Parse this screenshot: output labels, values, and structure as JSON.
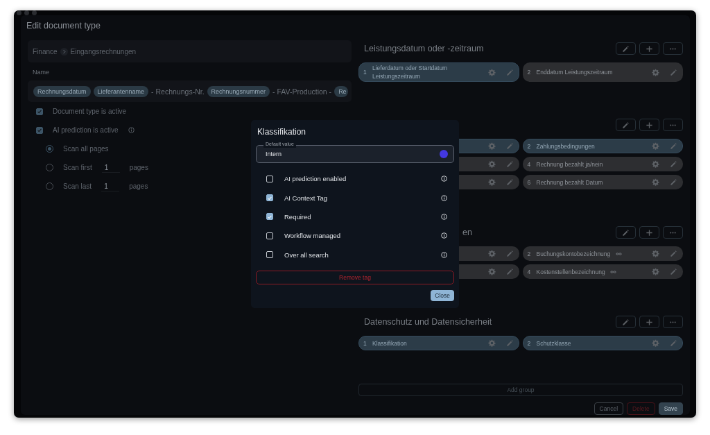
{
  "window": {
    "title": "Edit document type"
  },
  "breadcrumb": [
    "Finance",
    "Eingangsrechnungen"
  ],
  "name_field": {
    "label": "Name",
    "parts": [
      {
        "kind": "chip",
        "text": "Rechnungsdatum"
      },
      {
        "kind": "chip",
        "text": "Lieferantenname"
      },
      {
        "kind": "text",
        "text": "- Rechnungs-Nr."
      },
      {
        "kind": "chip",
        "text": "Rechnungsnummer"
      },
      {
        "kind": "text",
        "text": "- FAV-Production -"
      },
      {
        "kind": "chip",
        "text": "Re"
      }
    ]
  },
  "settings": [
    {
      "label": "Document type is active",
      "checked": true,
      "info": false
    },
    {
      "label": "AI prediction is active",
      "checked": true,
      "info": true
    }
  ],
  "scan_options": [
    {
      "before": "Scan all pages",
      "selected": true
    },
    {
      "before": "Scan first",
      "value": "1",
      "after": "pages",
      "selected": false
    },
    {
      "before": "Scan last",
      "value": "1",
      "after": "pages",
      "selected": false
    }
  ],
  "groups": [
    {
      "title": "Leistungsdatum oder -zeitraum",
      "title_cut": false,
      "tags": [
        {
          "number": "1",
          "label": "Lieferdatum oder Startdatum Leistungszeitraum",
          "highlighted": true,
          "linked": false
        },
        {
          "number": "2",
          "label": "Enddatum Leistungszeitraum",
          "highlighted": false,
          "linked": false
        }
      ]
    },
    {
      "tags": [
        {
          "highlighted": true
        },
        {
          "number": "2",
          "label": "Zahlungsbedingungen",
          "highlighted": true,
          "linked": false
        },
        {
          "highlighted": false
        },
        {
          "number": "4",
          "label": "Rechnung bezahlt ja/nein",
          "highlighted": false,
          "linked": false
        },
        {
          "highlighted": false
        },
        {
          "number": "6",
          "label": "Rechnung bezahlt Datum",
          "highlighted": false,
          "linked": false
        }
      ]
    },
    {
      "title": "en",
      "title_cut": true,
      "tags": [
        {
          "highlighted": false
        },
        {
          "number": "2",
          "label": "Buchungskontobezeichnung",
          "highlighted": false,
          "linked": true
        },
        {
          "highlighted": false
        },
        {
          "number": "4",
          "label": "Kostenstellenbezeichnung",
          "highlighted": false,
          "linked": true
        }
      ]
    },
    {
      "title": "Datenschutz und Datensicherheit",
      "title_cut": false,
      "tags": [
        {
          "number": "1",
          "label": "Klassifikation",
          "highlighted": true,
          "linked": false
        },
        {
          "number": "2",
          "label": "Schutzklasse",
          "highlighted": true,
          "linked": false
        }
      ]
    }
  ],
  "add_group": "Add group",
  "footer": [
    {
      "label": "Cancel",
      "kind": "outline"
    },
    {
      "label": "Delete",
      "kind": "danger"
    },
    {
      "label": "Save",
      "kind": "primary"
    }
  ],
  "dialog": {
    "title": "Klassifikation",
    "default_value": {
      "label": "Default value",
      "value": "Intern",
      "color": "#4338e0"
    },
    "options": [
      {
        "label": "AI prediction enabled",
        "checked": false
      },
      {
        "label": "AI Context Tag",
        "checked": true
      },
      {
        "label": "Required",
        "checked": true
      },
      {
        "label": "Workflow managed",
        "checked": false
      },
      {
        "label": "Over all search",
        "checked": false
      }
    ],
    "remove": "Remove tag",
    "close": "Close"
  }
}
